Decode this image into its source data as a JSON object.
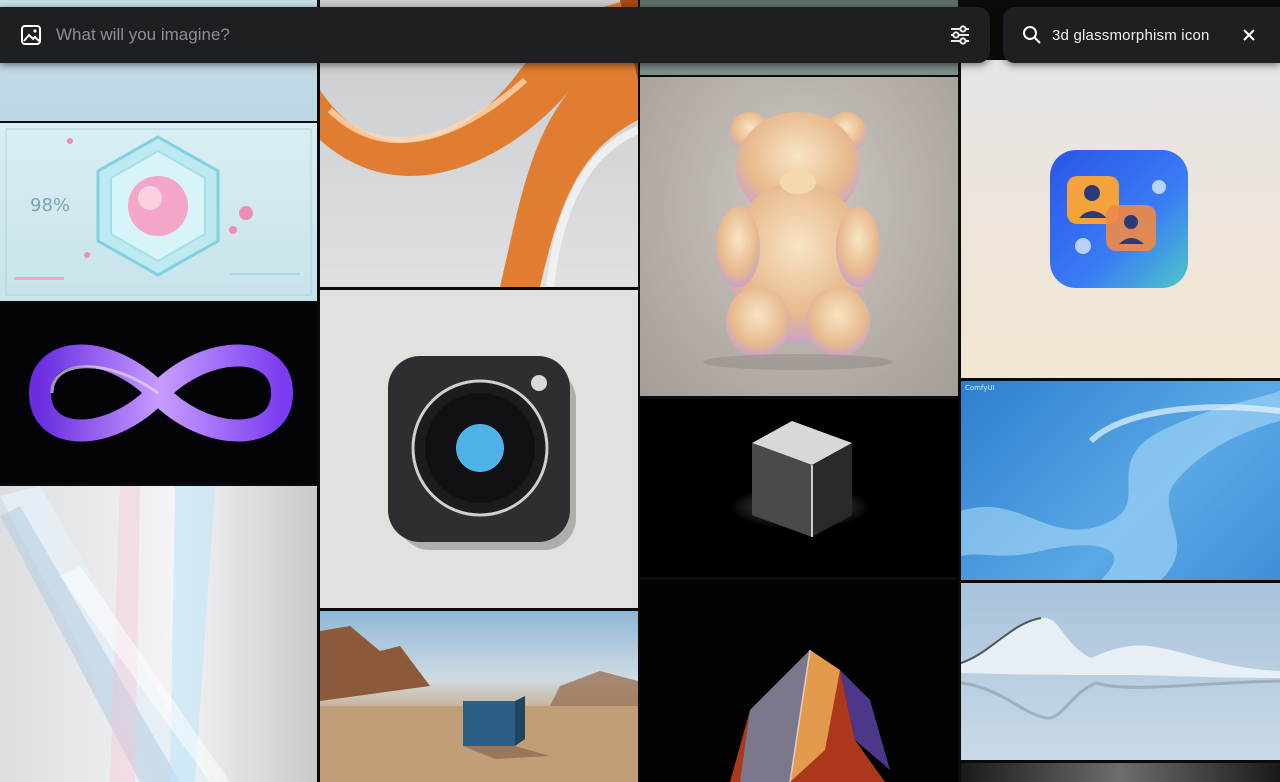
{
  "prompt_bar": {
    "placeholder": "What will you imagine?",
    "image_icon": "image-icon",
    "settings_icon": "sliders-icon"
  },
  "search": {
    "query": "3d glassmorphism icon",
    "search_icon": "search-icon",
    "clear_icon": "close-icon"
  },
  "gallery": {
    "tiles": [
      {
        "name": "hexagon-crystal-sphere-image",
        "overlay_text": "98%"
      },
      {
        "name": "orange-glass-ribbon-image"
      },
      {
        "name": "gummy-bear-image"
      },
      {
        "name": "chat-icon-glass-image"
      },
      {
        "name": "purple-infinity-image"
      },
      {
        "name": "camera-app-icon-image"
      },
      {
        "name": "black-glass-cube-image"
      },
      {
        "name": "blue-wave-image",
        "overlay_text": "ComfyUI"
      },
      {
        "name": "prism-shards-image"
      },
      {
        "name": "desert-cube-image"
      },
      {
        "name": "rainbow-crystal-image"
      },
      {
        "name": "silver-wave-landscape-image"
      }
    ]
  },
  "colors": {
    "bar_background": "#1e1f22",
    "placeholder_text": "#8d8f95",
    "query_text": "#f1f1f1"
  }
}
